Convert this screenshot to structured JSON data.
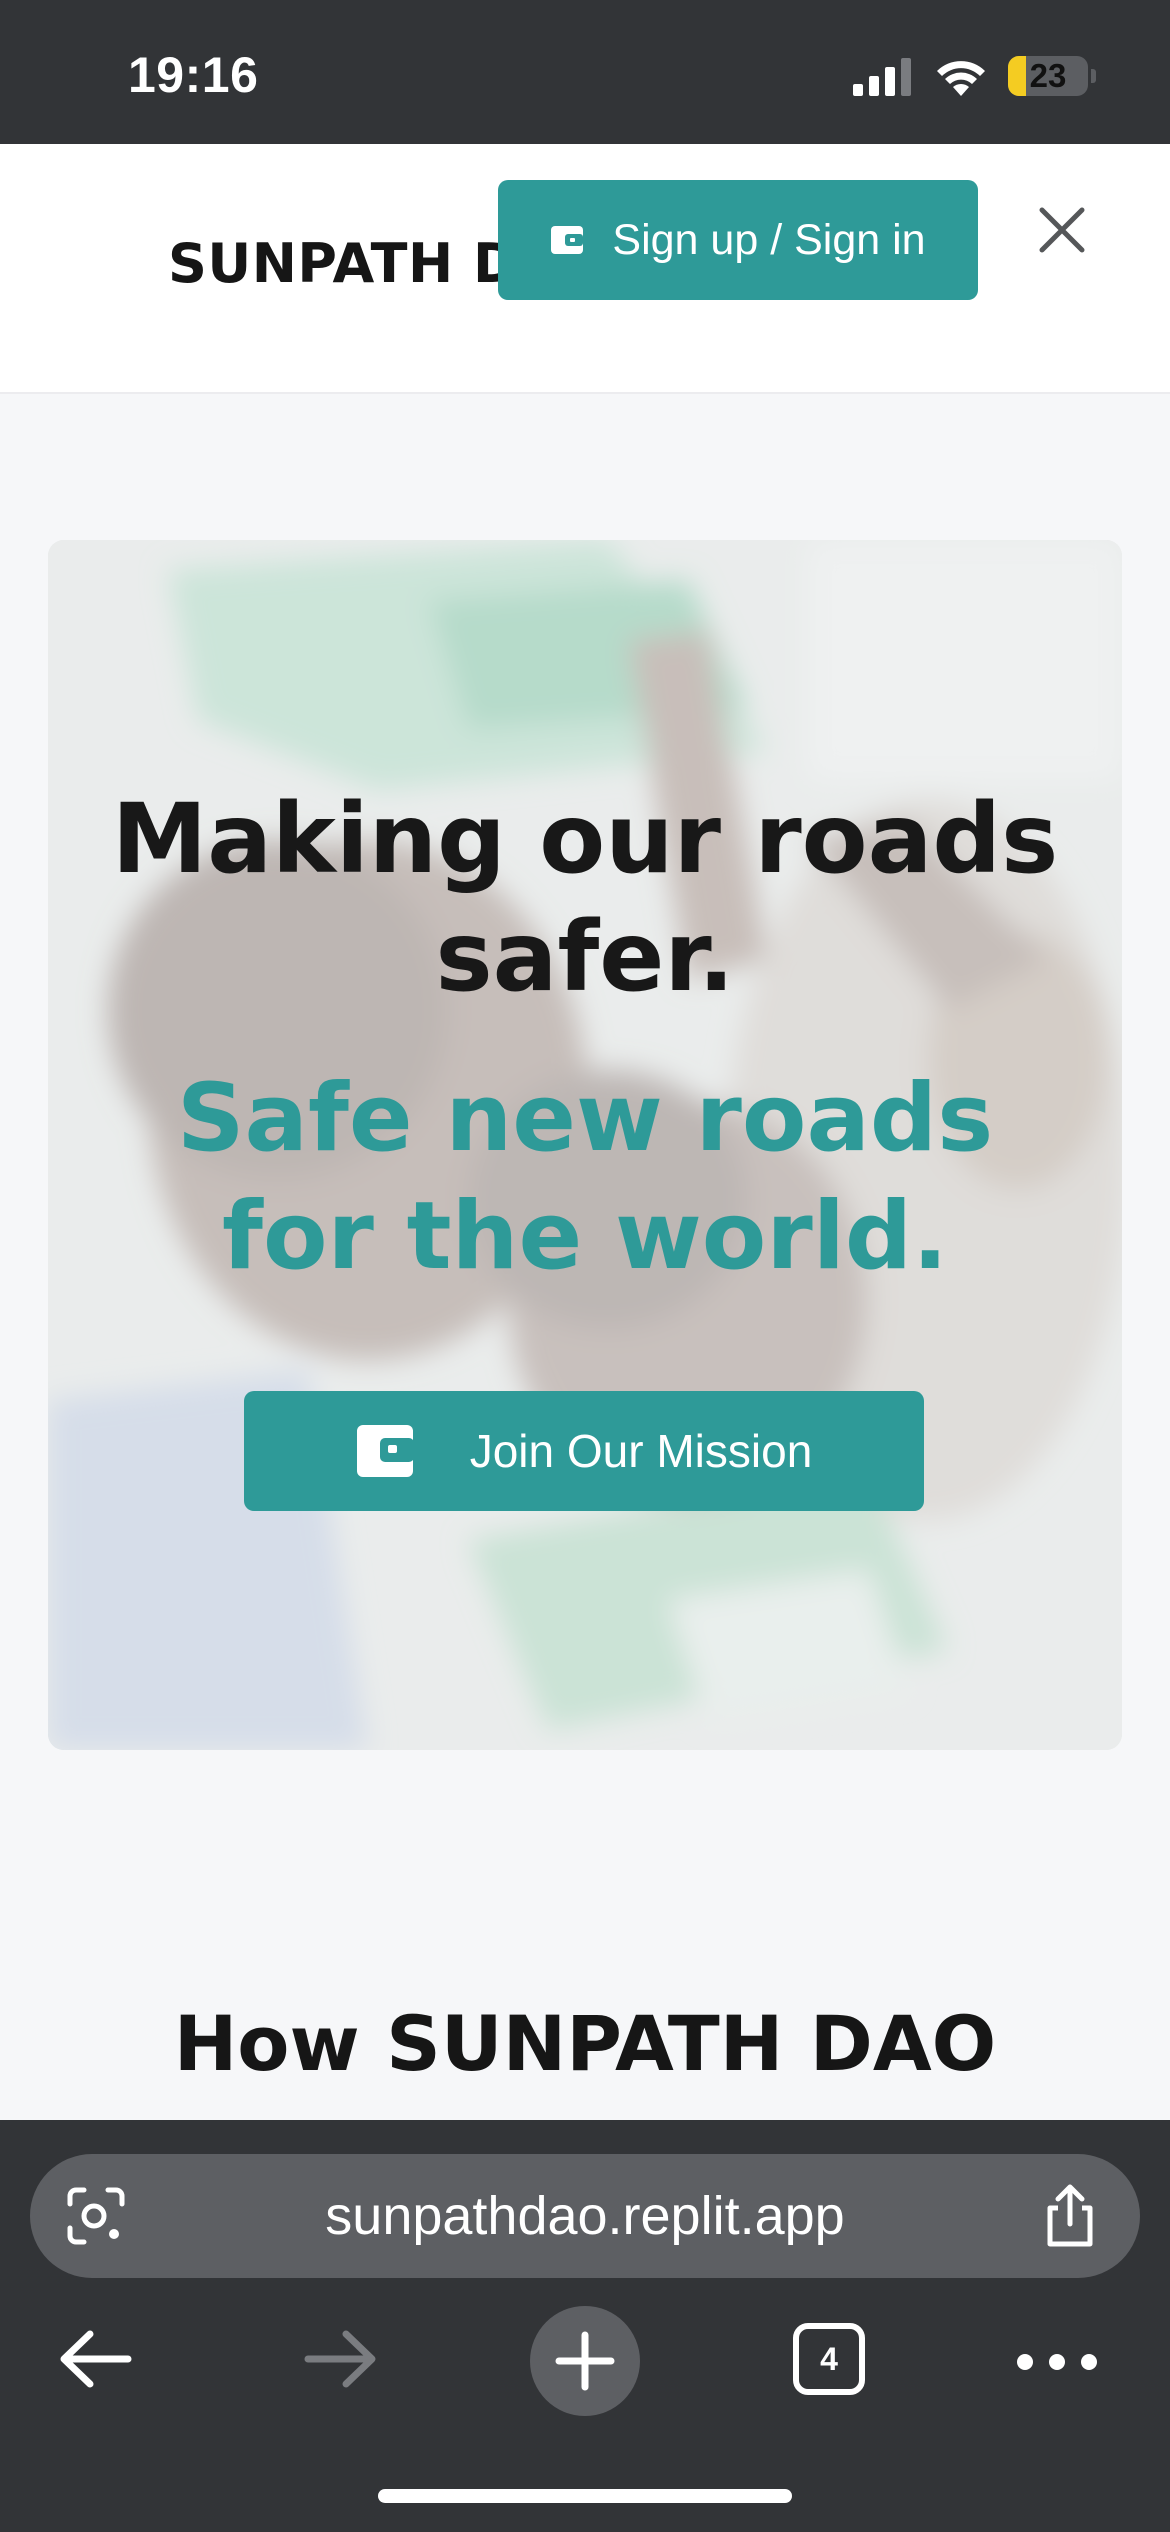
{
  "status_bar": {
    "time": "19:16",
    "battery_level": "23",
    "icons": [
      "cellular-signal-icon",
      "wifi-icon",
      "battery-icon"
    ]
  },
  "header": {
    "brand": "SUNPATH DAO",
    "signin_label": "Sign up / Sign in",
    "signin_icon": "wallet-icon",
    "close_icon": "close-icon"
  },
  "hero": {
    "title": "Making our roads safer.",
    "subtitle": "Safe new roads for the world.",
    "cta_label": "Join Our Mission",
    "cta_icon": "wallet-icon",
    "background": "crowd-photo-with-green-white-flags"
  },
  "section": {
    "heading": "How SUNPATH DAO Works"
  },
  "browser": {
    "url": "sunpathdao.replit.app",
    "tab_count": "4",
    "icons": [
      "lens-icon",
      "share-icon",
      "back-arrow-icon",
      "forward-arrow-icon",
      "plus-icon",
      "tabs-icon",
      "more-icon"
    ]
  },
  "colors": {
    "accent": "#2e9a98",
    "chrome": "#323437",
    "chrome_field": "#5d5f63",
    "page_bg": "#f6f7f9"
  }
}
